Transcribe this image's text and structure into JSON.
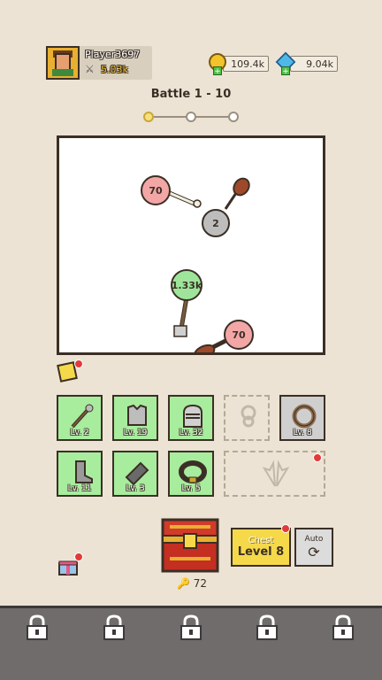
{
  "player": {
    "name": "Player3697",
    "power": "5.03k"
  },
  "currency": {
    "gold": "109.4k",
    "gems": "9.04k"
  },
  "battle": {
    "title": "Battle 1 - 10",
    "stage_progress": 0
  },
  "arena": {
    "balls": [
      {
        "label": "70",
        "type": "enemy"
      },
      {
        "label": "2",
        "type": "neutral"
      },
      {
        "label": "1.33k",
        "type": "player"
      },
      {
        "label": "70",
        "type": "enemy"
      }
    ]
  },
  "inventory": {
    "row1": [
      {
        "name": "spear",
        "level": "Lv. 2"
      },
      {
        "name": "chest-armor",
        "level": "Lv. 19"
      },
      {
        "name": "knight-helmet",
        "level": "Lv. 32"
      },
      {
        "name": "amulet",
        "level": "",
        "locked": true
      },
      {
        "name": "ring",
        "level": "Lv. 8"
      }
    ],
    "row2": [
      {
        "name": "boots",
        "level": "Lv. 11"
      },
      {
        "name": "gauntlet",
        "level": "Lv. 3"
      },
      {
        "name": "belt",
        "level": "Lv. 5"
      },
      {
        "name": "wings",
        "level": "",
        "locked": true
      }
    ]
  },
  "chest": {
    "keys": "72",
    "button_top": "Chest",
    "button_bottom": "Level 8"
  },
  "auto": {
    "label": "Auto"
  },
  "colors": {
    "accent_red": "#e23a3a",
    "slot_green": "#a8ec9e",
    "arena_border": "#3b2f25"
  }
}
